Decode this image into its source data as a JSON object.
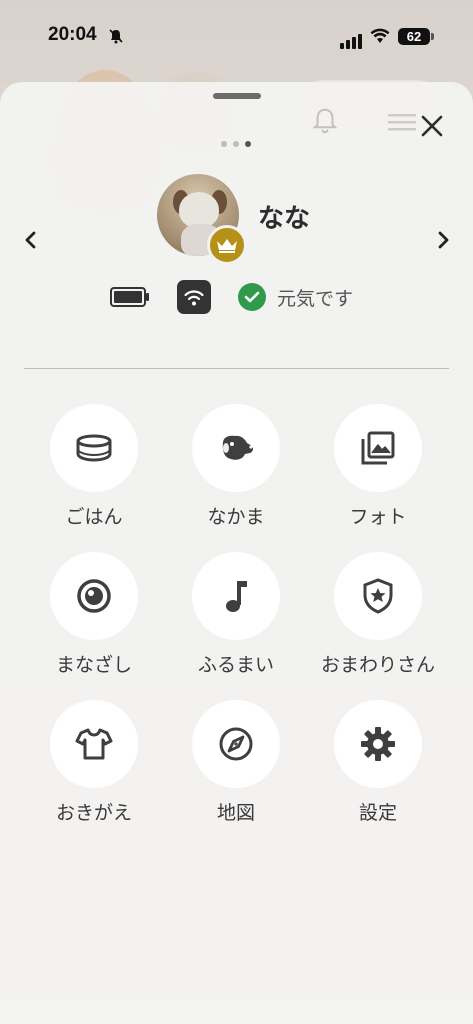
{
  "status_bar": {
    "time": "20:04",
    "battery_level": "62"
  },
  "profile": {
    "dog_name": "なな",
    "status_text": "元気です",
    "page_index": 3,
    "page_count": 3
  },
  "menu": {
    "items": [
      {
        "label": "ごはん",
        "icon": "food-bowl-icon"
      },
      {
        "label": "なかま",
        "icon": "dog-head-icon"
      },
      {
        "label": "フォト",
        "icon": "photo-library-icon"
      },
      {
        "label": "まなざし",
        "icon": "eye-icon"
      },
      {
        "label": "ふるまい",
        "icon": "music-note-icon"
      },
      {
        "label": "おまわりさん",
        "icon": "shield-star-icon"
      },
      {
        "label": "おきがえ",
        "icon": "tshirt-icon"
      },
      {
        "label": "地図",
        "icon": "compass-icon"
      },
      {
        "label": "設定",
        "icon": "gear-icon"
      }
    ]
  },
  "colors": {
    "crown_badge": "#b59118",
    "ok_green": "#2f9a4a",
    "divider": "#c9b8ab",
    "icon_dark": "#3f3f3f"
  }
}
